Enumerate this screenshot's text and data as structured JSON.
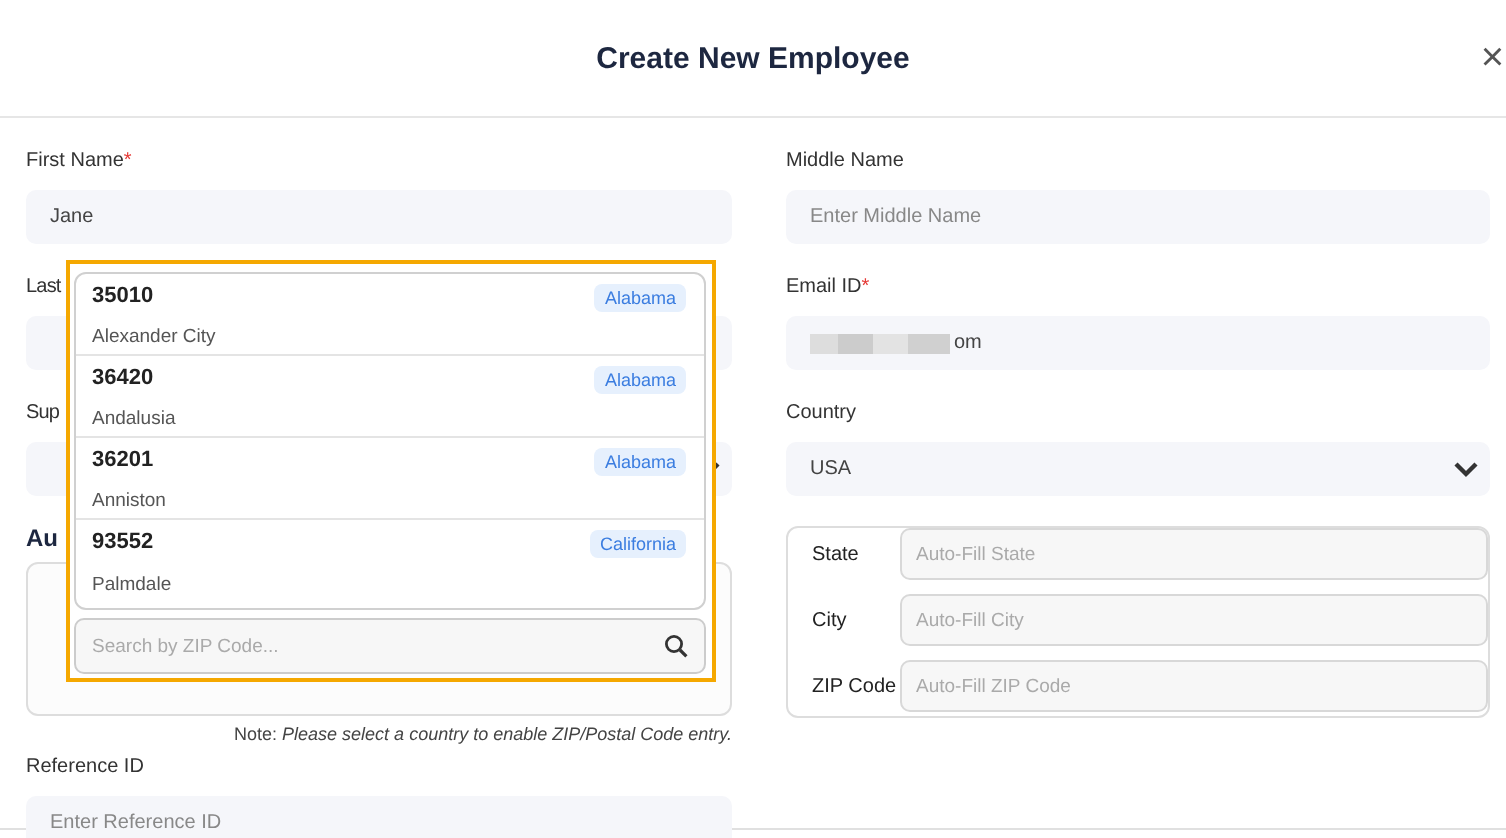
{
  "dialog": {
    "title": "Create New Employee",
    "close": "×"
  },
  "left": {
    "first_name": {
      "label": "First Name",
      "required": "*",
      "value": "Jane"
    },
    "last_name_label": "Last",
    "supervisor_label": "Sup",
    "address_heading": "Au",
    "note": {
      "prefix": "Note:",
      "text": "Please select a country to enable ZIP/Postal Code entry."
    },
    "reference": {
      "label": "Reference ID",
      "placeholder": "Enter Reference ID"
    }
  },
  "right": {
    "middle_name": {
      "label": "Middle Name",
      "placeholder": "Enter Middle Name"
    },
    "email": {
      "label": "Email ID",
      "required": "*",
      "value": "om"
    },
    "country": {
      "label": "Country",
      "value": "USA"
    },
    "address": [
      {
        "label": "State",
        "placeholder": "Auto-Fill State"
      },
      {
        "label": "City",
        "placeholder": "Auto-Fill City"
      },
      {
        "label": "ZIP Code",
        "placeholder": "Auto-Fill ZIP Code"
      }
    ]
  },
  "zip_dropdown": {
    "options": [
      {
        "zip": "35010",
        "city": "Alexander City",
        "state": "Alabama"
      },
      {
        "zip": "36420",
        "city": "Andalusia",
        "state": "Alabama"
      },
      {
        "zip": "36201",
        "city": "Anniston",
        "state": "Alabama"
      },
      {
        "zip": "93552",
        "city": "Palmdale",
        "state": "California"
      }
    ],
    "search_placeholder": "Search by ZIP Code..."
  }
}
